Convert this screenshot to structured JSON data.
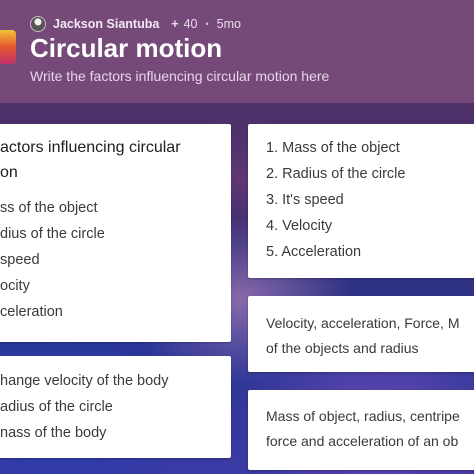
{
  "post": {
    "author": "Jackson Siantuba",
    "plus_symbol": "+",
    "likes": "40",
    "separator": "•",
    "age": "5mo",
    "title": "Circular motion",
    "subtitle": "Write the factors influencing circular motion here"
  },
  "cards": {
    "left_top": {
      "heading_line1": "actors influencing circular",
      "heading_line2": "on",
      "items": [
        "ss of the object",
        "dius of the circle",
        "speed",
        "ocity",
        "celeration"
      ]
    },
    "left_bottom": {
      "items": [
        "hange velocity of the body",
        "adius of the circle",
        "nass of the body"
      ]
    },
    "right_top": {
      "items": [
        "1. Mass of the object",
        "2. Radius of the circle",
        "3. It's speed",
        "4. Velocity",
        "5. Acceleration"
      ]
    },
    "right_middle": {
      "line1": "Velocity, acceleration,  Force, M",
      "line2": "of the objects and radius"
    },
    "right_bottom": {
      "line1": "Mass of object, radius, centripe",
      "line2": "force and acceleration of an ob"
    }
  },
  "colors": {
    "header": "#764a78",
    "card": "#ffffff"
  }
}
